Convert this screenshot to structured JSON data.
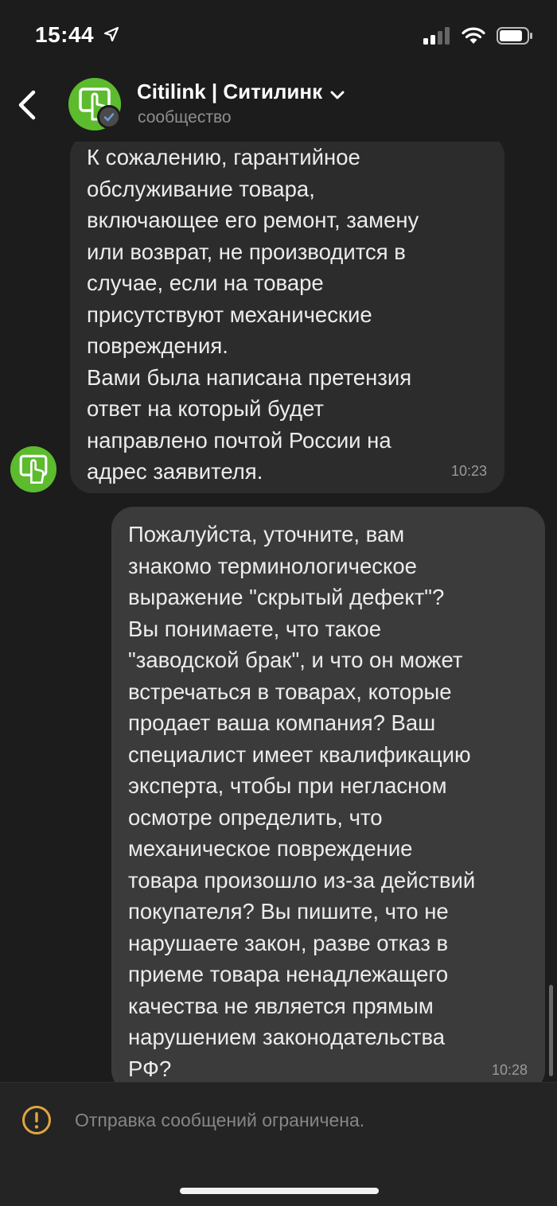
{
  "status_bar": {
    "time": "15:44",
    "icons": [
      "location-arrow-icon",
      "cellular-icon",
      "wifi-icon",
      "battery-icon"
    ]
  },
  "header": {
    "title": "Citilink | Ситилинк",
    "subtitle": "сообщество",
    "icons": [
      "back-chevron-icon",
      "chevron-down-icon",
      "verified-check-icon"
    ]
  },
  "messages": [
    {
      "direction": "incoming",
      "text": "К сожалению, гарантийное\nобслуживание товара,\nвключающее его ремонт, замену\nили возврат, не производится в\nслучае, если на товаре\nприсутствуют механические\nповреждения.\nВами была написана претензия\nответ на который будет\nнаправлено почтой России на\nадрес заявителя.",
      "time": "10:23"
    },
    {
      "direction": "outgoing",
      "text": "Пожалуйста, уточните, вам\nзнакомо терминологическое\nвыражение \"скрытый дефект\"?\nВы понимаете, что такое\n\"заводской брак\", и что он может\nвстречаться в товарах, которые\nпродает ваша компания? Ваш\nспециалист имеет квалификацию\nэксперта, чтобы при негласном\nосмотре определить, что\nмеханическое повреждение\nтовара произошло из-за действий\nпокупателя? Вы пишите, что не\nнарушаете закон, разве отказ в\nприеме товара ненадлежащего\nкачества не является прямым\nнарушением законодательства\nРФ?",
      "time": "10:28"
    }
  ],
  "composer": {
    "notice": "Отправка сообщений ограничена.",
    "icon": "warning-circle-icon"
  },
  "colors": {
    "background": "#1c1c1c",
    "incoming_bubble": "#2c2c2c",
    "outgoing_bubble": "#3b3b3b",
    "brand_green": "#5dbb2e",
    "warning": "#e0a640",
    "verified": "#6f9ae0"
  }
}
